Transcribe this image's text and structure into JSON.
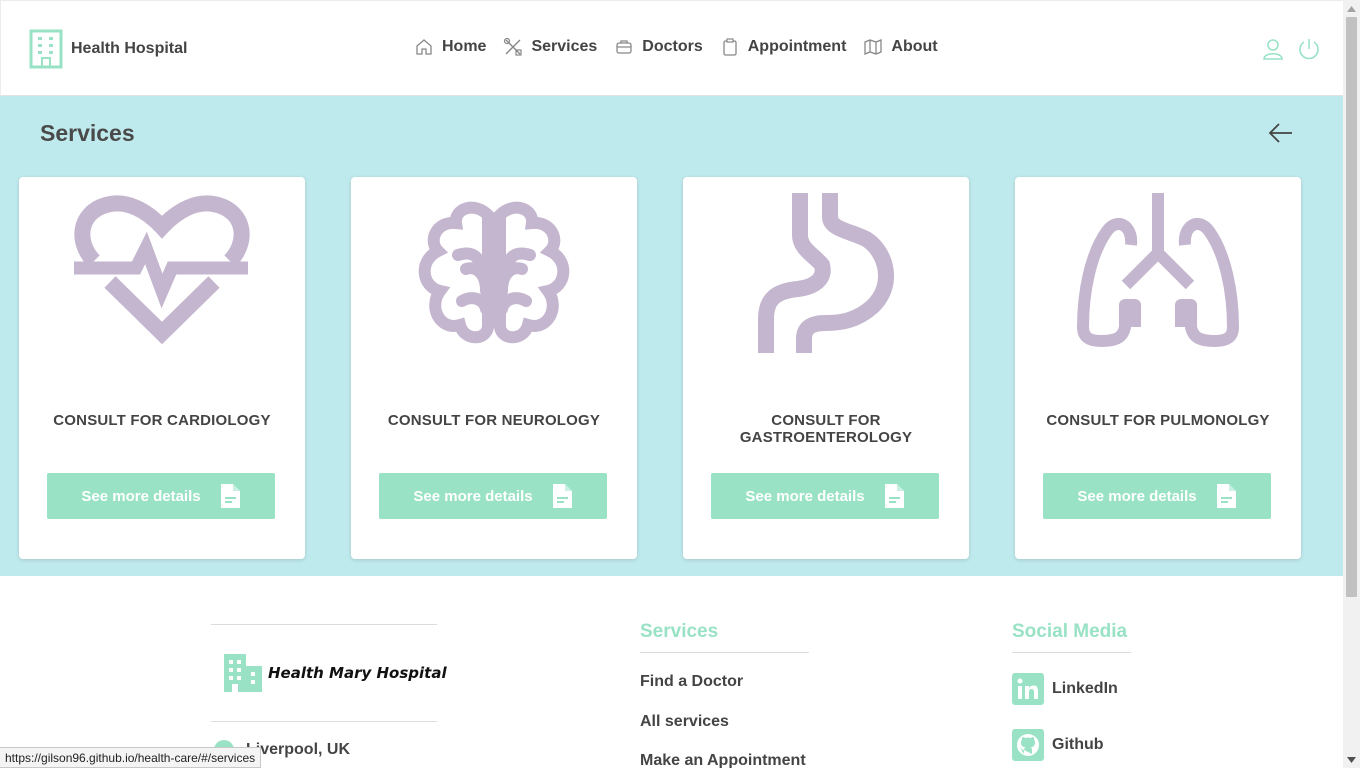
{
  "header": {
    "brand": "Health Hospital",
    "nav": [
      {
        "label": "Home",
        "icon": "home-icon"
      },
      {
        "label": "Services",
        "icon": "tools-icon"
      },
      {
        "label": "Doctors",
        "icon": "briefcase-icon"
      },
      {
        "label": "Appointment",
        "icon": "clipboard-icon"
      },
      {
        "label": "About",
        "icon": "map-icon"
      }
    ],
    "icons": [
      "user-icon",
      "power-icon"
    ]
  },
  "services": {
    "title": "Services",
    "cards": [
      {
        "name": "CONSULT FOR CARDIOLOGY",
        "icon": "heart-pulse-icon",
        "button": "See more details"
      },
      {
        "name": "CONSULT FOR NEUROLOGY",
        "icon": "brain-icon",
        "button": "See more details"
      },
      {
        "name": "CONSULT FOR GASTROENTEROLOGY",
        "icon": "stomach-icon",
        "button": "See more details"
      },
      {
        "name": "CONSULT FOR PULMONOLGY",
        "icon": "lungs-icon",
        "button": "See more details"
      }
    ]
  },
  "footer": {
    "logo_text": "Health Mary Hospital",
    "location": "Liverpool, UK",
    "services_heading": "Services",
    "services_links": [
      "Find a Doctor",
      "All services",
      "Make an Appointment"
    ],
    "social_heading": "Social Media",
    "social_links": [
      {
        "label": "LinkedIn",
        "icon": "linkedin-icon"
      },
      {
        "label": "Github",
        "icon": "github-icon"
      }
    ]
  },
  "status_bar": "https://gilson96.github.io/health-care/#/services",
  "colors": {
    "accent": "#99e2c6",
    "section_bg": "#bfeaed",
    "icon_purple": "#c5b6cf",
    "text": "#444444"
  }
}
